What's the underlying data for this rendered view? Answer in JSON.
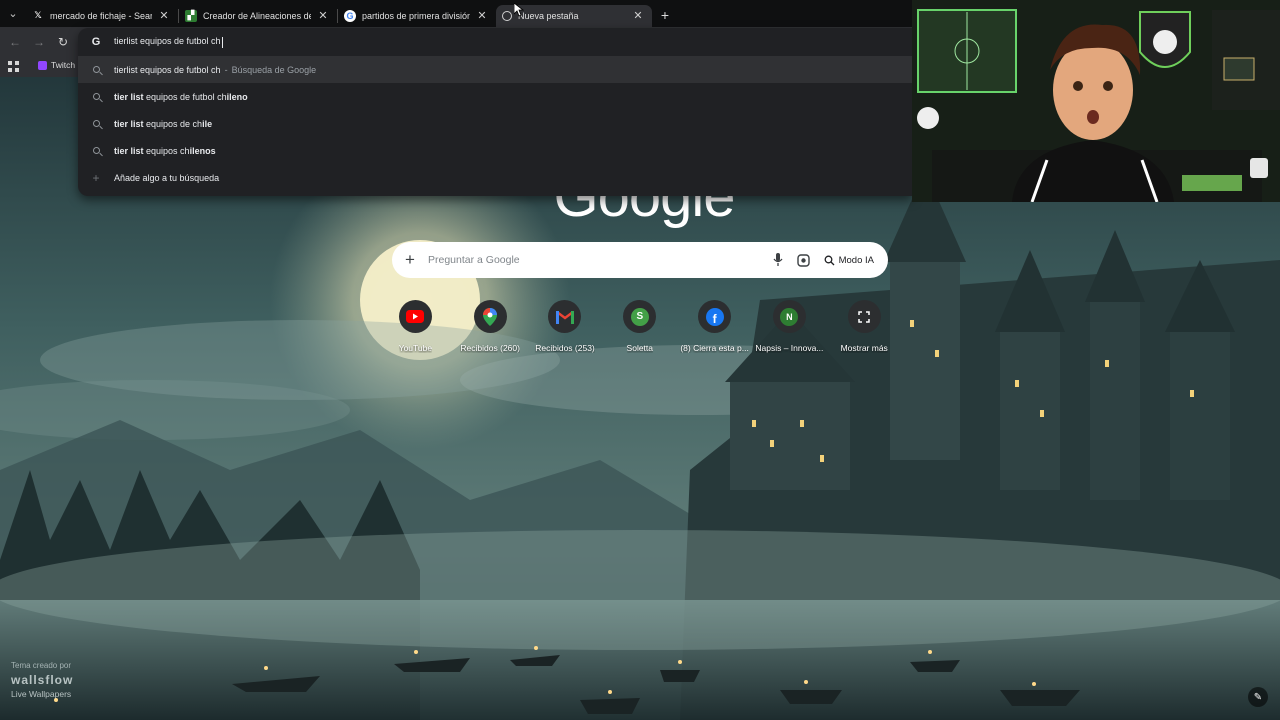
{
  "browser": {
    "tabs": [
      {
        "title": "mercado de fichaje - Search / X",
        "favicon": "x-icon",
        "active": false
      },
      {
        "title": "Creador de Alineaciones de Fútbol",
        "favicon": "lineup-icon",
        "active": false
      },
      {
        "title": "partidos de primera división de",
        "favicon": "google-icon",
        "active": false
      },
      {
        "title": "Nueva pestaña",
        "favicon": "chrome-icon",
        "active": true
      }
    ],
    "bookmarks": [
      {
        "label": "Twitch"
      }
    ]
  },
  "omnibox": {
    "query": "tierlist equipos de futbol ch",
    "suggestions": [
      {
        "bold": "",
        "text": "tierlist equipos de futbol ch",
        "suffix_sep": "-",
        "suffix": "Búsqueda de Google",
        "highlighted": true,
        "icon": "search-icon"
      },
      {
        "bold": "tier list",
        "text": " equipos de futbol ch",
        "bold_tail": "ileno",
        "icon": "search-icon"
      },
      {
        "bold": "tier list",
        "text": " equipos de ch",
        "bold_tail": "ile",
        "icon": "search-icon"
      },
      {
        "bold": "tier list",
        "text": " equipos ch",
        "bold_tail": "ilenos",
        "icon": "search-icon"
      },
      {
        "bold": "",
        "text": "Añade algo a tu búsqueda",
        "icon": "plus-icon"
      }
    ]
  },
  "newtab": {
    "logo_text": "Google",
    "search_placeholder": "Preguntar a Google",
    "ai_mode_label": "Modo IA",
    "shortcuts": [
      {
        "label": "YouTube",
        "icon": "youtube-icon",
        "color": "#ff0000"
      },
      {
        "label": "Recibidos (260)",
        "icon": "maps-icon",
        "color": "#34a853"
      },
      {
        "label": "Recibidos (253)",
        "icon": "gmail-icon",
        "color": "#ea4335"
      },
      {
        "label": "Soletta",
        "icon": "soletta-icon",
        "color": "#43a047",
        "letter": "S"
      },
      {
        "label": "(8) Cierra esta p...",
        "icon": "facebook-icon",
        "color": "#1877f2"
      },
      {
        "label": "Napsis – Innova...",
        "icon": "napsis-icon",
        "color": "#2e7d32",
        "letter": "N"
      },
      {
        "label": "Mostrar más",
        "icon": "expand-icon",
        "color": "#ffffff"
      }
    ],
    "theme_credit": {
      "line1": "Tema creado por",
      "brand": "wallsflow",
      "line3": "Live Wallpapers"
    }
  }
}
